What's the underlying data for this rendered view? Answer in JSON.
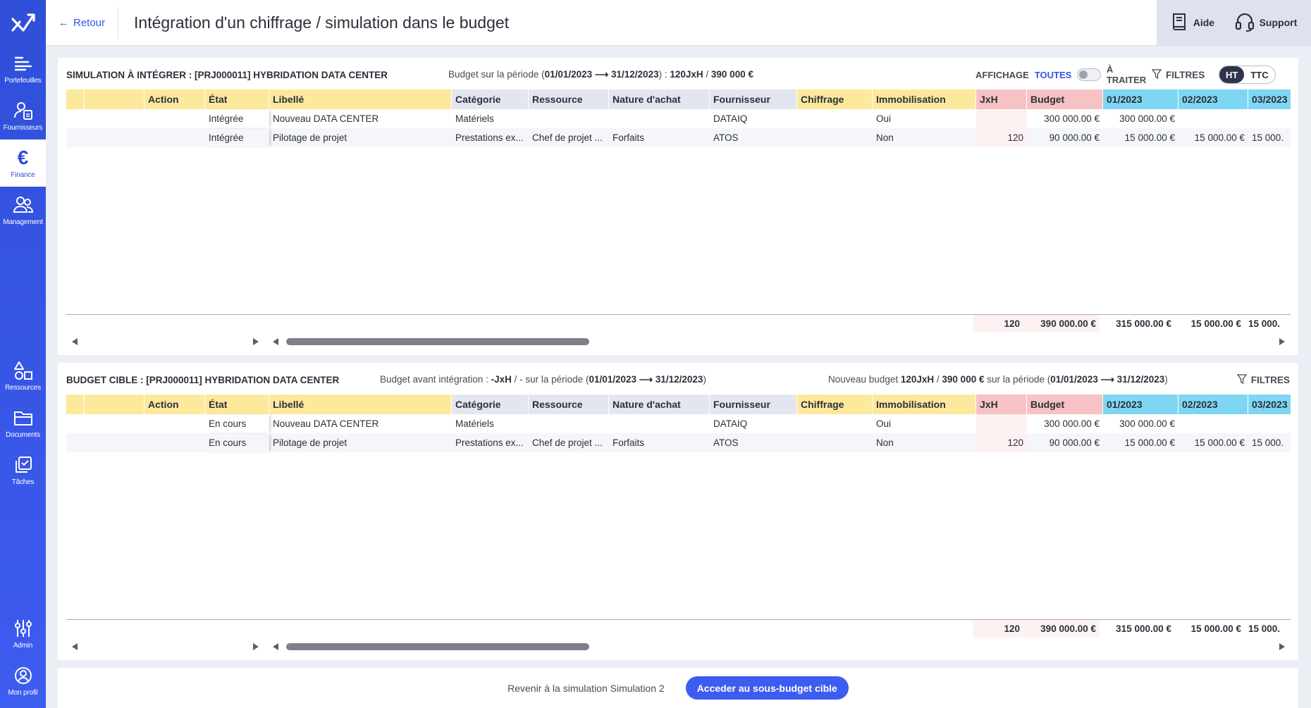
{
  "sidebar": {
    "logo_icon": "brand-logo-icon",
    "items_top": [
      {
        "label": "Portefeuilles",
        "icon": "portfolio-icon"
      },
      {
        "label": "Fournisseurs",
        "icon": "supplier-icon"
      },
      {
        "label": "Finance",
        "icon": "euro-icon",
        "active": true
      },
      {
        "label": "Management",
        "icon": "people-icon"
      }
    ],
    "items_middle": [
      {
        "label": "Ressources",
        "icon": "shapes-icon"
      },
      {
        "label": "Documents",
        "icon": "folder-icon"
      },
      {
        "label": "Tâches",
        "icon": "tasks-icon"
      }
    ],
    "items_bottom": [
      {
        "label": "Admin",
        "icon": "sliders-icon"
      },
      {
        "label": "Mon profil",
        "icon": "profile-icon"
      }
    ]
  },
  "header": {
    "back_label": "Retour",
    "title": "Intégration d'un chiffrage / simulation dans le budget",
    "help_label": "Aide",
    "support_label": "Support"
  },
  "columns": [
    "",
    "",
    "Action",
    "État",
    "Libellé",
    "Catégorie",
    "Ressource",
    "Nature d'achat",
    "Fournisseur",
    "Chiffrage",
    "Immobilisation",
    "JxH",
    "Budget",
    "01/2023",
    "02/2023",
    "03/2023"
  ],
  "top_panel": {
    "title": "SIMULATION À INTÉGRER : [PRJ000011] HYBRIDATION DATA CENTER",
    "info_prefix": "Budget sur la période (",
    "info_period": "01/01/2023 ⟶ 31/12/2023",
    "info_mid": ") : ",
    "info_jxh": "120JxH",
    "info_sep": " / ",
    "info_amount": "390 000 €",
    "affichage_label": "AFFICHAGE",
    "toutes_label": "TOUTES",
    "a_traiter_label": "À TRAITER",
    "filtres_label": "FILTRES",
    "ht_label": "HT",
    "ttc_label": "TTC",
    "rows": [
      {
        "etat": "Intégrée",
        "libelle": "Nouveau DATA CENTER",
        "categorie": "Matériels",
        "ressource": "",
        "nature": "",
        "fournisseur": "DATAIQ",
        "chiffrage": "",
        "immobilisation": "Oui",
        "jxh": "",
        "budget": "300 000.00 €",
        "m01": "300 000.00 €",
        "m02": "",
        "m03": ""
      },
      {
        "etat": "Intégrée",
        "libelle": "Pilotage de projet",
        "categorie": "Prestations ex...",
        "ressource": "Chef de projet ...",
        "nature": "Forfaits",
        "fournisseur": "ATOS",
        "chiffrage": "",
        "immobilisation": "Non",
        "jxh": "120",
        "budget": "90 000.00 €",
        "m01": "15 000.00 €",
        "m02": "15 000.00 €",
        "m03": "15 000."
      }
    ],
    "totals": {
      "jxh": "120",
      "budget": "390 000.00 €",
      "m01": "315 000.00 €",
      "m02": "15 000.00 €",
      "m03": "15 000."
    }
  },
  "bottom_panel": {
    "title": "BUDGET CIBLE : [PRJ000011] HYBRIDATION DATA CENTER",
    "before_prefix": "Budget avant intégration : ",
    "before_jxh": "-JxH",
    "before_mid": " / - sur la période (",
    "before_period": "01/01/2023 ⟶ 31/12/2023",
    "before_suffix": ")",
    "new_prefix": "Nouveau budget ",
    "new_jxh": "120JxH",
    "new_sep": " / ",
    "new_amount": "390 000 €",
    "new_mid": " sur la période (",
    "new_period": "01/01/2023 ⟶ 31/12/2023",
    "new_suffix": ")",
    "filtres_label": "FILTRES",
    "rows": [
      {
        "etat": "En cours",
        "libelle": "Nouveau DATA CENTER",
        "categorie": "Matériels",
        "ressource": "",
        "nature": "",
        "fournisseur": "DATAIQ",
        "chiffrage": "",
        "immobilisation": "Oui",
        "jxh": "",
        "budget": "300 000.00 €",
        "m01": "300 000.00 €",
        "m02": "",
        "m03": ""
      },
      {
        "etat": "En cours",
        "libelle": "Pilotage de projet",
        "categorie": "Prestations ex...",
        "ressource": "Chef de projet ...",
        "nature": "Forfaits",
        "fournisseur": "ATOS",
        "chiffrage": "",
        "immobilisation": "Non",
        "jxh": "120",
        "budget": "90 000.00 €",
        "m01": "15 000.00 €",
        "m02": "15 000.00 €",
        "m03": "15 000."
      }
    ],
    "totals": {
      "jxh": "120",
      "budget": "390 000.00 €",
      "m01": "315 000.00 €",
      "m02": "15 000.00 €",
      "m03": "15 000."
    }
  },
  "footer": {
    "back_simulation_label": "Revenir à la simulation Simulation 2",
    "access_button_label": "Acceder au sous-budget cible"
  },
  "colors": {
    "accent": "#3d5cf0",
    "header_yellow": "#fde99c",
    "header_grey": "#e4e6ef",
    "header_pink": "#f7c2c4",
    "header_blue": "#7fd6f3"
  }
}
